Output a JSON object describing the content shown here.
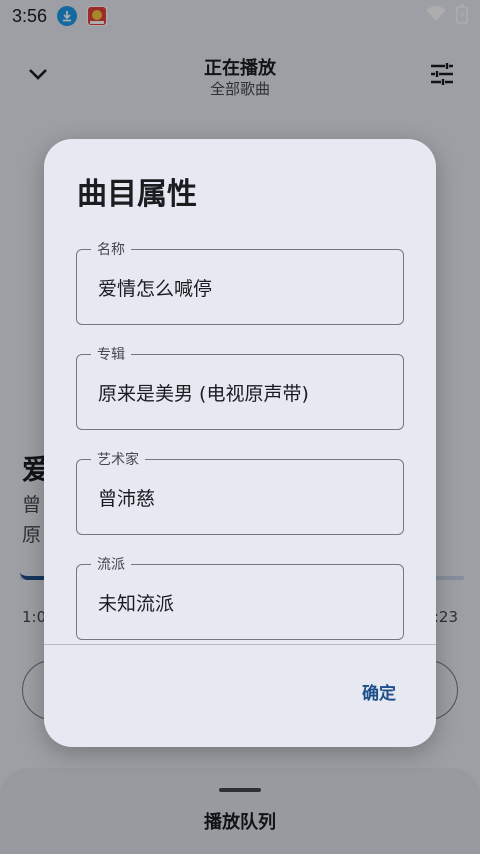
{
  "status_bar": {
    "time": "3:56",
    "icons": [
      "download-notification-icon",
      "app-notification-icon",
      "wifi-icon",
      "battery-charging-icon"
    ]
  },
  "header": {
    "title": "正在播放",
    "subtitle": "全部歌曲",
    "back_icon": "chevron-down-icon",
    "eq_icon": "equalizer-icon"
  },
  "player": {
    "title": "爱",
    "artist": "曾",
    "album": "原",
    "time_current": "1:0",
    "time_total": ":23"
  },
  "queue": {
    "label": "播放队列"
  },
  "dialog": {
    "title": "曲目属性",
    "fields": [
      {
        "label": "名称",
        "value": "爱情怎么喊停"
      },
      {
        "label": "专辑",
        "value": "原来是美男 (电视原声带)"
      },
      {
        "label": "艺术家",
        "value": "曾沛慈"
      },
      {
        "label": "流派",
        "value": "未知流派"
      }
    ],
    "confirm_label": "确定"
  },
  "colors": {
    "accent": "#1f4f8b",
    "background": "#e7eaf2",
    "dialog_surface": "#e6e9f1",
    "download_badge": "#1e9be9"
  }
}
